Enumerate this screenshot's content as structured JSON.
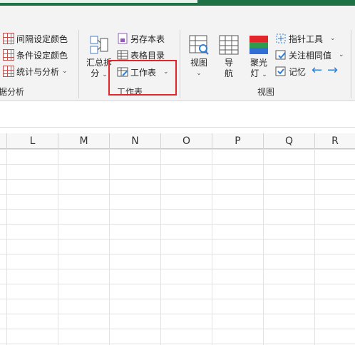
{
  "ribbon": {
    "left_group": {
      "items": [
        "间隔设定颜色",
        "条件设定颜色",
        "统计与分析"
      ],
      "label_partial": "据分析"
    },
    "worksheet_group": {
      "summary_split_label_line1": "汇总拆",
      "summary_split_label_line2": "分",
      "save_as_label": "另存本表",
      "table_dir_label": "表格目录",
      "worksheet_label": "工作表",
      "label": "工作表"
    },
    "view_group": {
      "view_label": "视图",
      "nav_label_line1": "导",
      "nav_label_line2": "航",
      "spotlight_label_line1": "聚光",
      "spotlight_label_line2": "灯",
      "pointer_tool_label": "指针工具",
      "watch_same_label": "关注相同值",
      "memory_label": "记忆",
      "label": "视图",
      "arrow_left": "←",
      "arrow_right": "→"
    }
  },
  "sheet": {
    "columns": [
      "L",
      "M",
      "N",
      "O",
      "P",
      "Q",
      "R"
    ]
  }
}
